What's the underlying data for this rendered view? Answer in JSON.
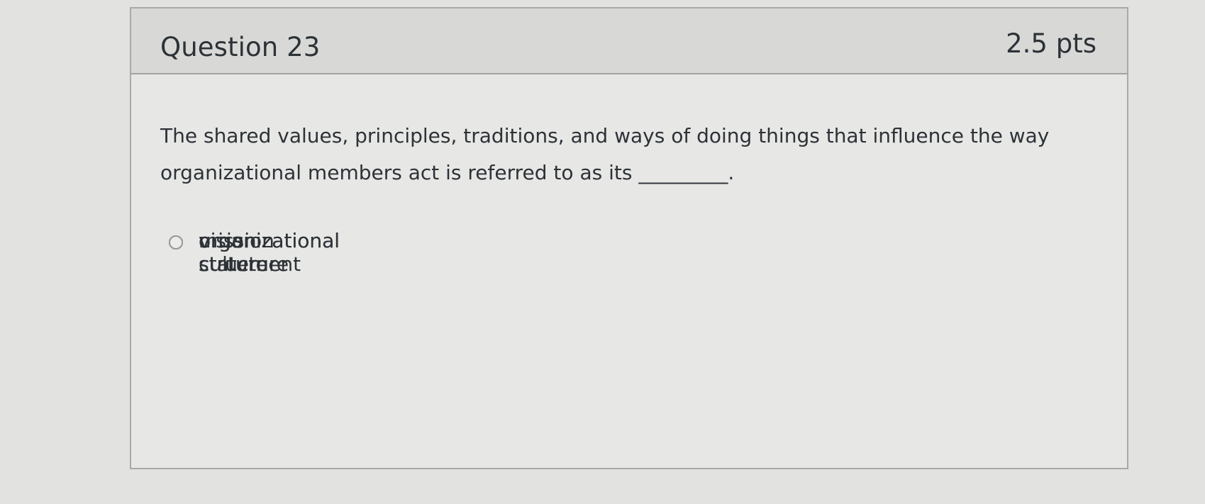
{
  "question": {
    "title": "Question 23",
    "points": "2.5 pts",
    "text": "The shared values, principles, traditions, and ways of doing things that influence the way organizational members act is referred to as its _________."
  },
  "answers": [
    {
      "label": "organizational culture"
    },
    {
      "label": "mission statement"
    },
    {
      "label": "vision"
    },
    {
      "label": "organizational structure"
    }
  ]
}
